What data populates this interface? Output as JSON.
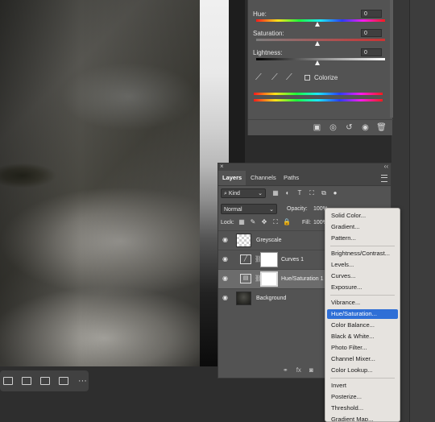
{
  "properties": {
    "hue_label": "Hue:",
    "hue_value": "0",
    "saturation_label": "Saturation:",
    "saturation_value": "0",
    "lightness_label": "Lightness:",
    "lightness_value": "0",
    "colorize_label": "Colorize"
  },
  "layers_panel": {
    "tabs": [
      "Layers",
      "Channels",
      "Paths"
    ],
    "filter_kind": "Kind",
    "blend_mode": "Normal",
    "opacity_label": "Opacity:",
    "opacity_value": "100%",
    "lock_label": "Lock:",
    "fill_label": "Fill:",
    "fill_value": "100%",
    "layers": [
      {
        "name": "Greyscale"
      },
      {
        "name": "Curves 1"
      },
      {
        "name": "Hue/Saturation 1"
      },
      {
        "name": "Background"
      }
    ]
  },
  "context_menu": {
    "items": [
      "Solid Color...",
      "Gradient...",
      "Pattern...",
      "Brightness/Contrast...",
      "Levels...",
      "Curves...",
      "Exposure...",
      "Vibrance...",
      "Hue/Saturation...",
      "Color Balance...",
      "Black & White...",
      "Photo Filter...",
      "Channel Mixer...",
      "Color Lookup...",
      "Invert",
      "Posterize...",
      "Threshold...",
      "Gradient Map..."
    ],
    "highlighted": "Hue/Saturation..."
  },
  "toolbar": {
    "more_label": "···"
  }
}
